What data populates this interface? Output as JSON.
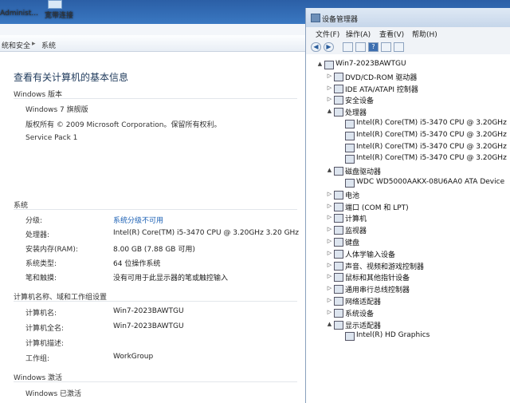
{
  "desktop": {
    "icons": [
      {
        "label": "Administ...",
        "icon": "user-folder-icon"
      },
      {
        "label": "宽带连接",
        "icon": "broadband-connection-icon"
      }
    ]
  },
  "control_panel": {
    "breadcrumb": [
      "统和安全",
      "系统"
    ],
    "page_title": "查看有关计算机的基本信息",
    "windows_edition": {
      "heading": "Windows 版本",
      "edition": "Windows 7 旗舰版",
      "copyright": "版权所有 © 2009 Microsoft Corporation。保留所有权利。",
      "service_pack": "Service Pack 1"
    },
    "system": {
      "heading": "系统",
      "rows": [
        {
          "label": "分级:",
          "value": "系统分级不可用",
          "link": true
        },
        {
          "label": "处理器:",
          "value": "Intel(R) Core(TM) i5-3470 CPU @ 3.20GHz   3.20 GHz",
          "link": false
        },
        {
          "label": "安装内存(RAM):",
          "value": "8.00 GB (7.88 GB 可用)",
          "link": false
        },
        {
          "label": "系统类型:",
          "value": "64 位操作系统",
          "link": false
        },
        {
          "label": "笔和触摸:",
          "value": "没有可用于此显示器的笔或触控输入",
          "link": false
        }
      ]
    },
    "computer_name": {
      "heading": "计算机名称、域和工作组设置",
      "rows": [
        {
          "label": "计算机名:",
          "value": "Win7-2023BAWTGU"
        },
        {
          "label": "计算机全名:",
          "value": "Win7-2023BAWTGU"
        },
        {
          "label": "计算机描述:",
          "value": ""
        },
        {
          "label": "工作组:",
          "value": "WorkGroup"
        }
      ]
    },
    "activation": {
      "heading": "Windows 激活",
      "status": "Windows 已激活"
    }
  },
  "device_manager": {
    "title": "设备管理器",
    "menu": [
      "文件(F)",
      "操作(A)",
      "查看(V)",
      "帮助(H)"
    ],
    "toolbar": [
      "back-icon",
      "forward-icon",
      "properties-icon",
      "view-icon",
      "help-icon",
      "details-icon",
      "scan-hardware-icon"
    ],
    "tree": [
      {
        "label": "Win7-2023BAWTGU",
        "level": 0,
        "toggle": "▲",
        "icon": "computer-icon"
      },
      {
        "label": "DVD/CD-ROM 驱动器",
        "level": 1,
        "toggle": "▷",
        "icon": "dvd-drive-icon"
      },
      {
        "label": "IDE ATA/ATAPI 控制器",
        "level": 1,
        "toggle": "▷",
        "icon": "ide-controller-icon"
      },
      {
        "label": "安全设备",
        "level": 1,
        "toggle": "▷",
        "icon": "security-device-icon"
      },
      {
        "label": "处理器",
        "level": 1,
        "toggle": "▲",
        "icon": "processor-icon"
      },
      {
        "label": "Intel(R) Core(TM) i5-3470 CPU @ 3.20GHz",
        "level": 2,
        "toggle": "",
        "icon": "cpu-icon"
      },
      {
        "label": "Intel(R) Core(TM) i5-3470 CPU @ 3.20GHz",
        "level": 2,
        "toggle": "",
        "icon": "cpu-icon"
      },
      {
        "label": "Intel(R) Core(TM) i5-3470 CPU @ 3.20GHz",
        "level": 2,
        "toggle": "",
        "icon": "cpu-icon"
      },
      {
        "label": "Intel(R) Core(TM) i5-3470 CPU @ 3.20GHz",
        "level": 2,
        "toggle": "",
        "icon": "cpu-icon"
      },
      {
        "label": "磁盘驱动器",
        "level": 1,
        "toggle": "▲",
        "icon": "disk-drive-icon"
      },
      {
        "label": "WDC WD5000AAKX-08U6AA0 ATA Device",
        "level": 2,
        "toggle": "",
        "icon": "hard-disk-icon"
      },
      {
        "label": "电池",
        "level": 1,
        "toggle": "▷",
        "icon": "battery-icon"
      },
      {
        "label": "端口 (COM 和 LPT)",
        "level": 1,
        "toggle": "▷",
        "icon": "port-icon"
      },
      {
        "label": "计算机",
        "level": 1,
        "toggle": "▷",
        "icon": "computer-icon"
      },
      {
        "label": "监视器",
        "level": 1,
        "toggle": "▷",
        "icon": "monitor-icon"
      },
      {
        "label": "键盘",
        "level": 1,
        "toggle": "▷",
        "icon": "keyboard-icon"
      },
      {
        "label": "人体学输入设备",
        "level": 1,
        "toggle": "▷",
        "icon": "hid-icon"
      },
      {
        "label": "声音、视频和游戏控制器",
        "level": 1,
        "toggle": "▷",
        "icon": "sound-icon"
      },
      {
        "label": "鼠标和其他指针设备",
        "level": 1,
        "toggle": "▷",
        "icon": "mouse-icon"
      },
      {
        "label": "通用串行总线控制器",
        "level": 1,
        "toggle": "▷",
        "icon": "usb-icon"
      },
      {
        "label": "网络适配器",
        "level": 1,
        "toggle": "▷",
        "icon": "network-adapter-icon"
      },
      {
        "label": "系统设备",
        "level": 1,
        "toggle": "▷",
        "icon": "system-device-icon"
      },
      {
        "label": "显示适配器",
        "level": 1,
        "toggle": "▲",
        "icon": "display-adapter-icon"
      },
      {
        "label": "Intel(R) HD Graphics",
        "level": 2,
        "toggle": "",
        "icon": "display-adapter-icon"
      }
    ]
  }
}
